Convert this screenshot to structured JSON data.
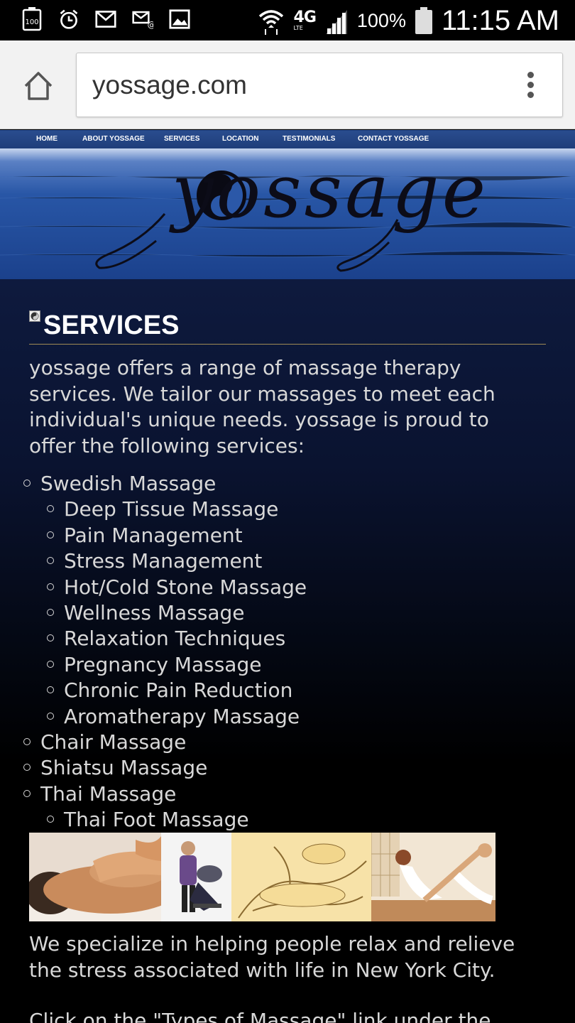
{
  "status_bar": {
    "battery_small": "100",
    "network": "4G",
    "network_sub": "LTE",
    "battery_pct": "100%",
    "time": "11:15 AM"
  },
  "browser": {
    "url": "yossage.com"
  },
  "nav": {
    "items": [
      "HOME",
      "ABOUT YOSSAGE",
      "SERVICES",
      "LOCATION",
      "TESTIMONIALS",
      "CONTACT YOSSAGE"
    ]
  },
  "banner": {
    "logo_text": "yossage"
  },
  "page": {
    "title": "SERVICES",
    "intro": "yossage offers a range of massage therapy services. We tailor our massages to meet each individual's unique needs. yossage is proud to offer the following services:",
    "services": [
      {
        "label": "Swedish Massage",
        "level": 1
      },
      {
        "label": "Deep Tissue Massage",
        "level": 2
      },
      {
        "label": "Pain Management",
        "level": 2
      },
      {
        "label": "Stress Management",
        "level": 2
      },
      {
        "label": "Hot/Cold Stone Massage",
        "level": 2
      },
      {
        "label": "Wellness Massage",
        "level": 2
      },
      {
        "label": "Relaxation Techniques",
        "level": 2
      },
      {
        "label": "Pregnancy Massage",
        "level": 2
      },
      {
        "label": "Chronic Pain Reduction",
        "level": 2
      },
      {
        "label": "Aromatherapy Massage",
        "level": 2
      },
      {
        "label": "Chair Massage",
        "level": 1
      },
      {
        "label": "Shiatsu Massage",
        "level": 1
      },
      {
        "label": "Thai Massage",
        "level": 1
      },
      {
        "label": "Thai Foot Massage",
        "level": 2
      }
    ],
    "closing": "We specialize in helping people relax and relieve the stress associated with life in New York City.",
    "closing2": "Click on the \"Types of Massage\" link under the"
  },
  "colors": {
    "nav_bg": "#1f3e7a",
    "rule": "#a08a55",
    "text": "#d8d8d8"
  }
}
